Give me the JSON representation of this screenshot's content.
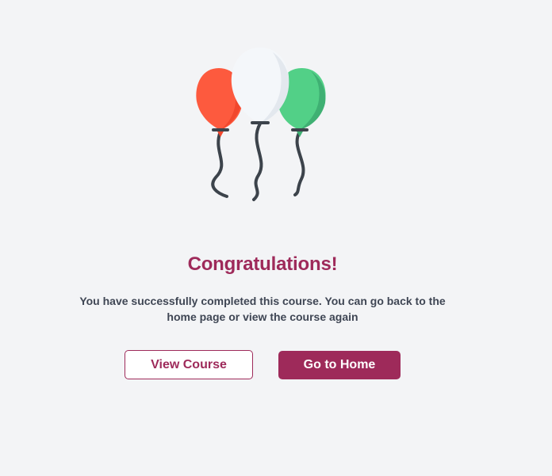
{
  "illustration": {
    "name": "balloons",
    "colors": {
      "red": "#fd5a3e",
      "red_shade": "#f1472d",
      "white": "#f4f7fa",
      "white_shade": "#e3e8ee",
      "green": "#52d087",
      "green_shade": "#3fb073",
      "string": "#3c434b"
    }
  },
  "completion": {
    "title": "Congratulations!",
    "message": "You have successfully completed this course. You can go back to the home page or view the course again"
  },
  "actions": {
    "view_course_label": "View Course",
    "go_home_label": "Go to Home"
  },
  "theme": {
    "accent": "#9e2a5a",
    "background": "#f3f4f6",
    "text": "#3f4654"
  }
}
